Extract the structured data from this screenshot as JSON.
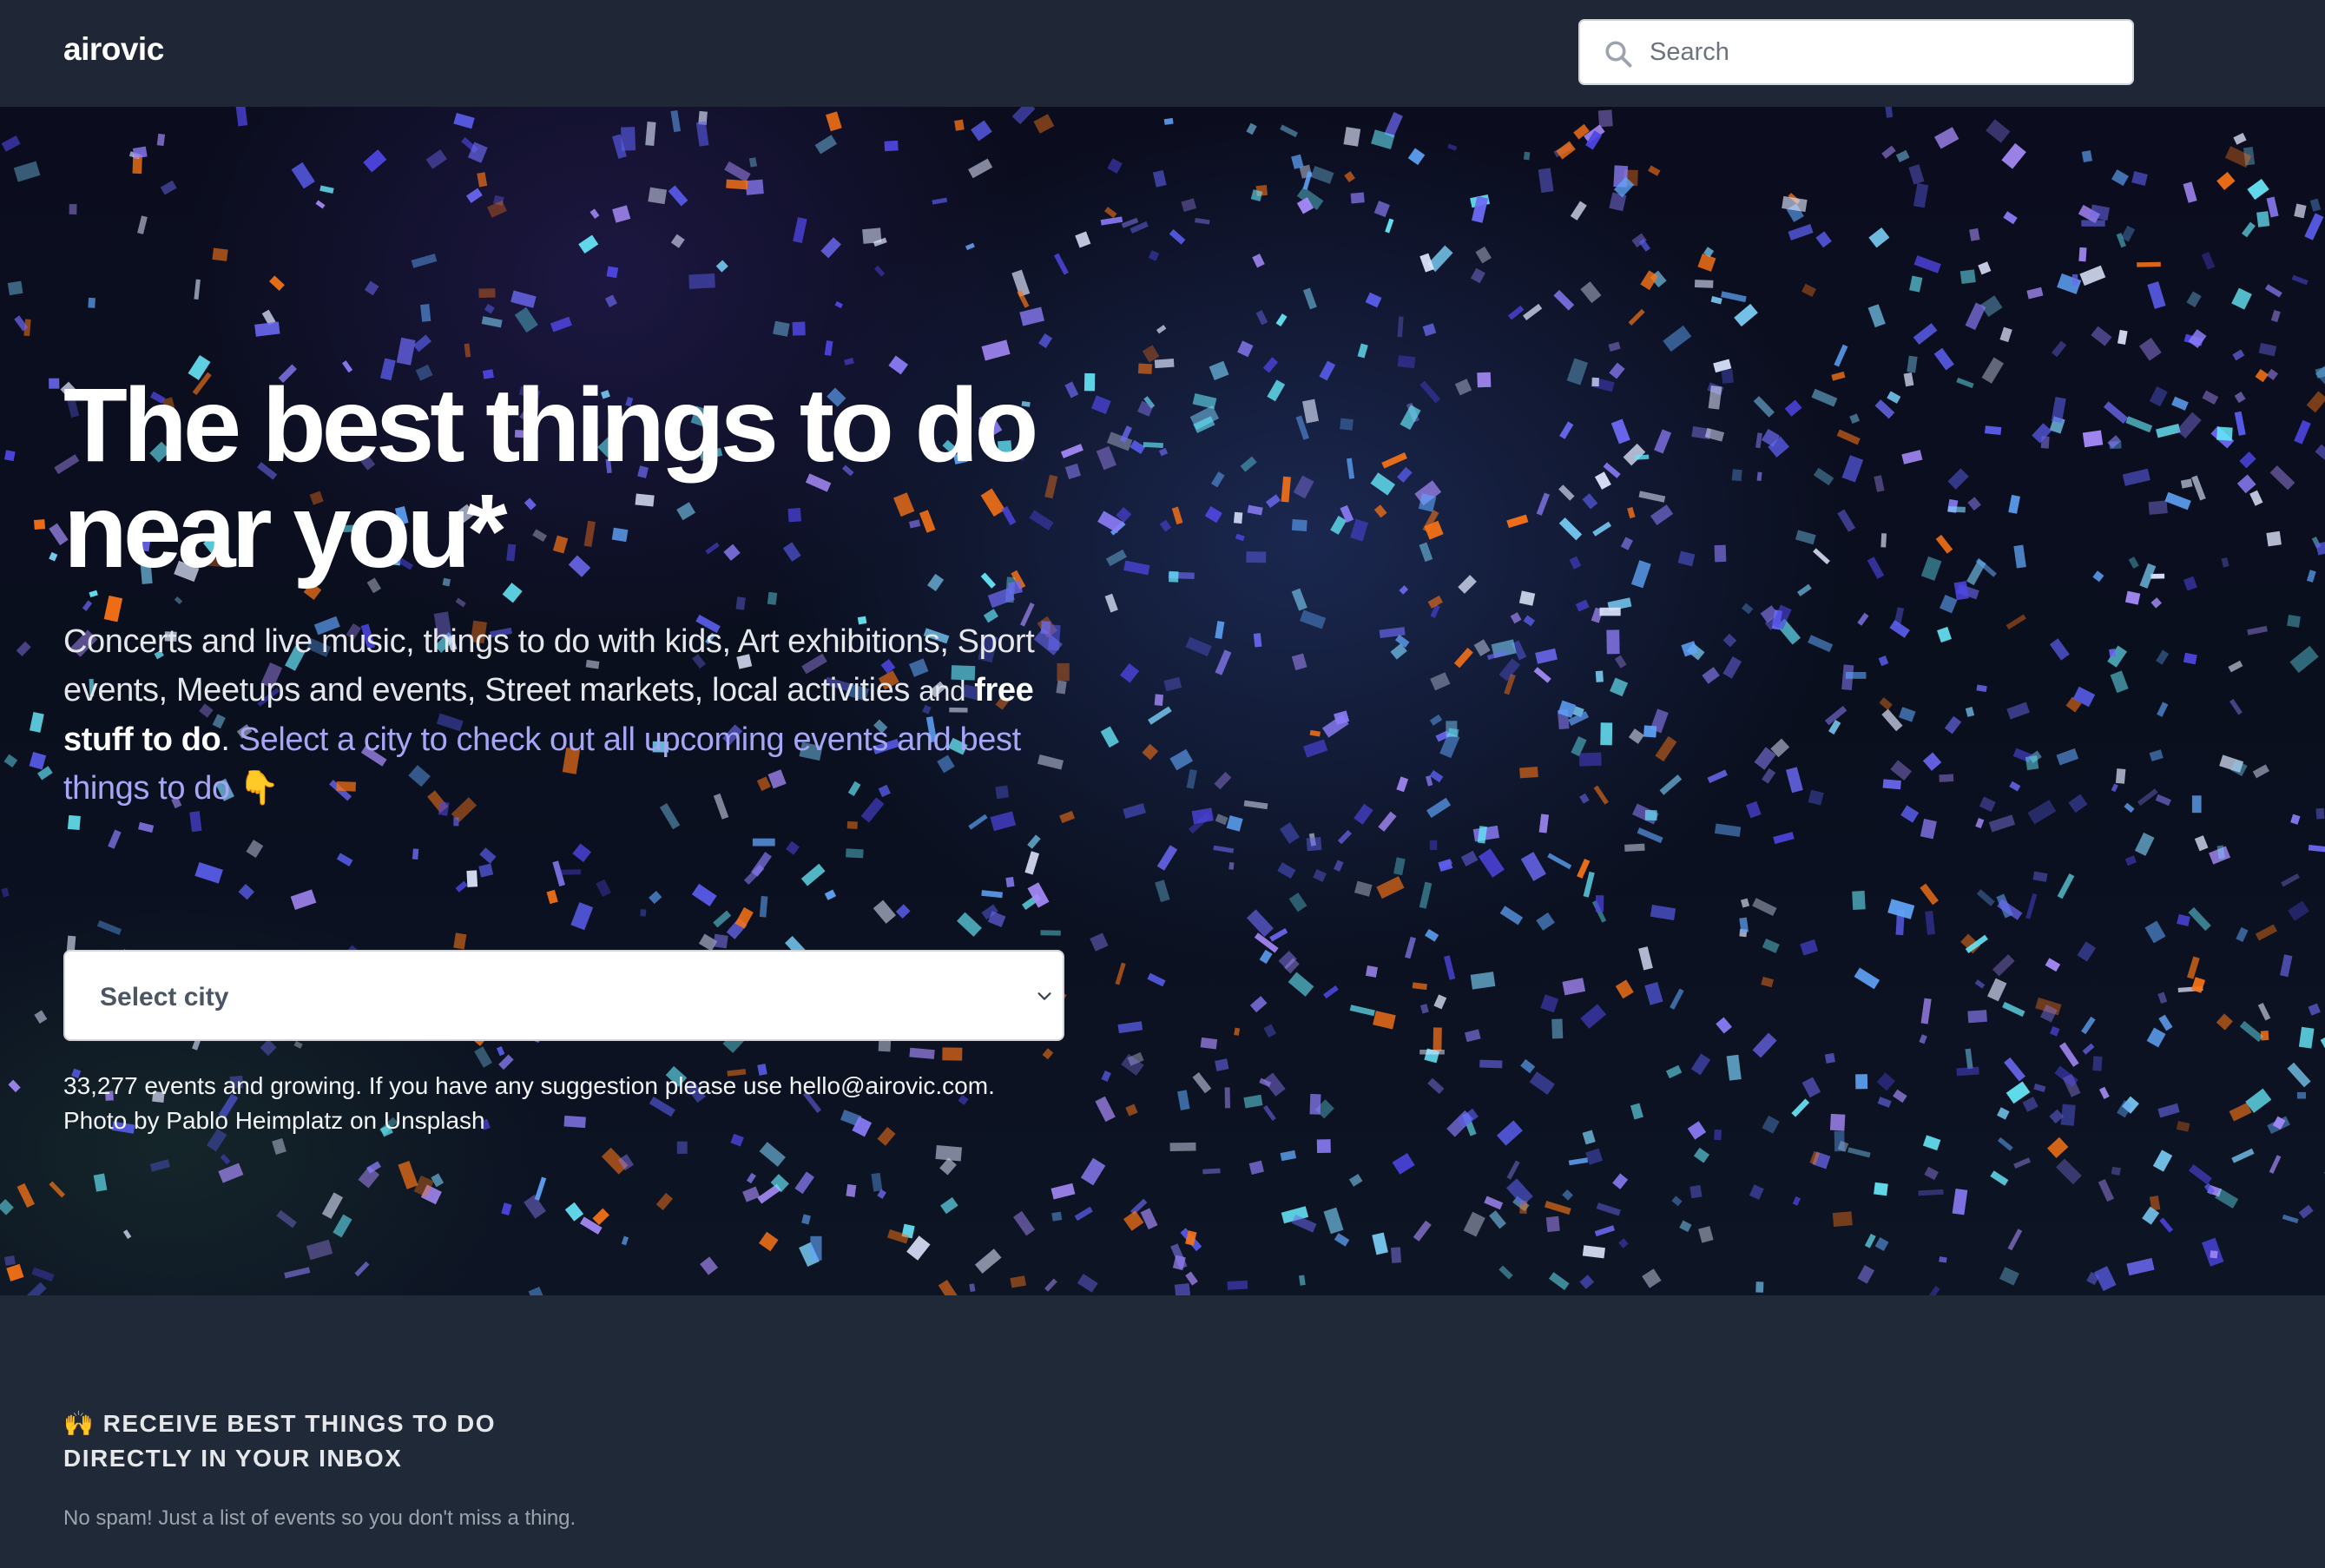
{
  "header": {
    "logo": "airovic",
    "search": {
      "placeholder": "Search",
      "icon": "search-icon"
    }
  },
  "hero": {
    "title": "The best things to do near you*",
    "description": {
      "part1": "Concerts and live music, things to do with kids, Art exhibitions, Sport events, Meetups and events, Street markets, local activities",
      "and": "and",
      "free_stuff": "free stuff to do",
      "period": ".",
      "cta_link": "Select a city to check out all upcoming events and best things to do 👇"
    },
    "city_select": {
      "placeholder": "Select city",
      "icon": "chevron-down-icon"
    },
    "stats_line": "33,277 events and growing. If you have any suggestion please use hello@airovic.com.",
    "photo_credit": "Photo by Pablo Heimplatz on Unsplash"
  },
  "newsletter": {
    "title": "🙌 Receive best things to do directly in your inbox",
    "note": "No spam! Just a list of events so you don't miss a thing."
  },
  "colors": {
    "navbar": "#1f2737",
    "page_bg": "#1f2937",
    "link": "#a5a6f6"
  }
}
